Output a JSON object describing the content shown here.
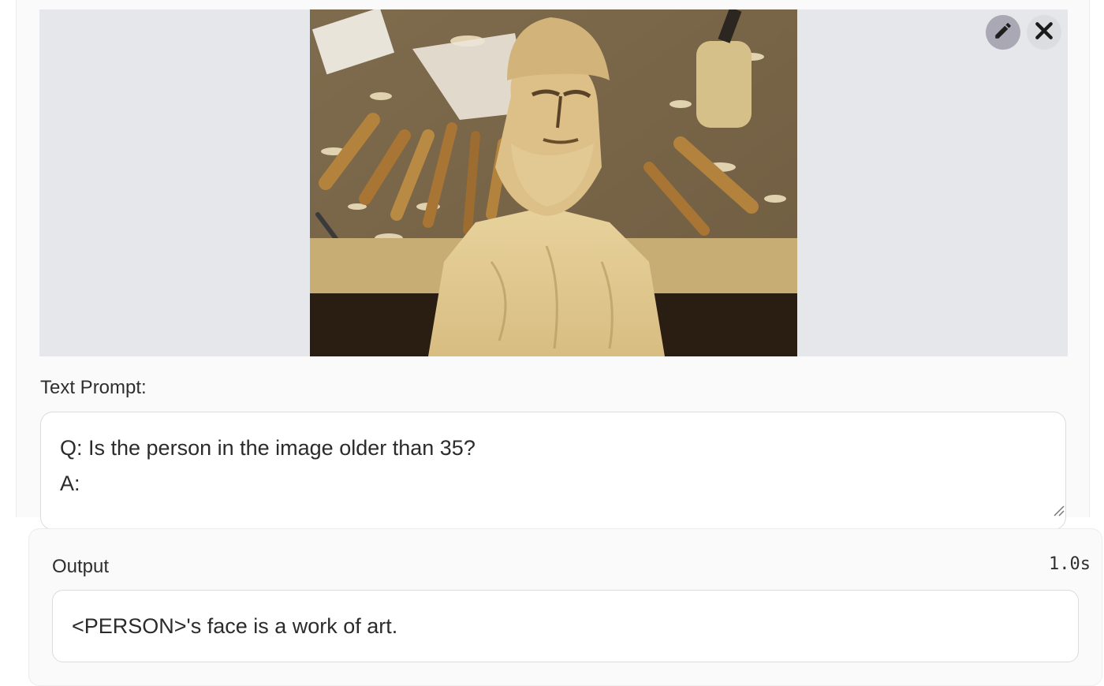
{
  "input_panel": {
    "image": {
      "alt": "wood-carving-bust-photo",
      "edit_icon": "pencil-icon",
      "close_icon": "close-icon"
    },
    "prompt_label": "Text Prompt:",
    "prompt_lines": [
      "Q: Is the person in the image older than 35?",
      "A:"
    ]
  },
  "output_panel": {
    "label": "Output",
    "timing": "1.0s",
    "text": "<PERSON>'s face is a work of art."
  },
  "colors": {
    "image_area_bg": "#e6e7ea",
    "edit_button_bg": "#a9a8b4",
    "close_button_bg": "#dcdde1",
    "panel_bg": "#fafafa"
  }
}
